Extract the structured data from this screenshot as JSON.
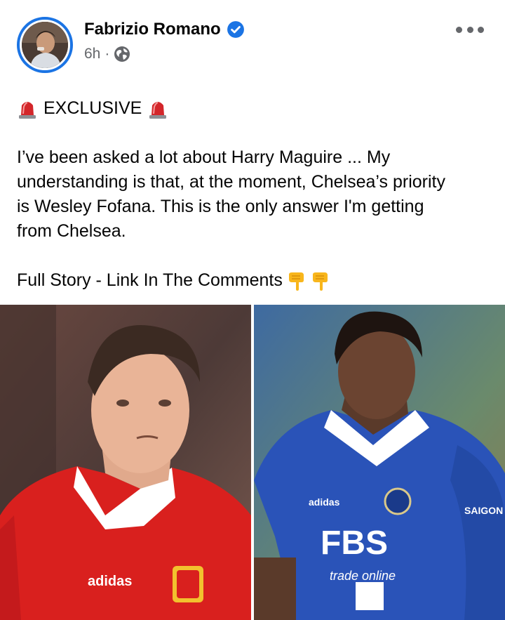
{
  "post": {
    "author": {
      "name": "Fabrizio Romano",
      "verified": true,
      "avatar_icon": "profile-photo"
    },
    "meta": {
      "time": "6h",
      "separator": "·",
      "audience_icon": "globe-icon"
    },
    "more_icon": "more-dots-icon",
    "headline": {
      "emoji_left": "siren-icon",
      "text": "EXCLUSIVE",
      "emoji_right": "siren-icon"
    },
    "body_lines": [
      "I’ve been asked a lot about Harry Maguire ... My",
      "understanding is that, at the moment, Chelsea’s priority",
      "is Wesley Fofana. This is the only answer I'm getting",
      "from Chelsea."
    ],
    "cta": {
      "text": "Full Story - Link In The Comments",
      "emojis": [
        "backhand-index-pointing-down-icon",
        "backhand-index-pointing-down-icon"
      ]
    },
    "images": [
      {
        "subject": "player-in-red-manchester-united-kit",
        "jersey_brand": "adidas"
      },
      {
        "subject": "player-in-blue-leicester-city-kit",
        "jersey_sponsor": "FBS",
        "jersey_sub": "trade online",
        "jersey_brand": "adidas",
        "sleeve_sponsor": "SAIGON"
      }
    ],
    "colors": {
      "accent": "#1b74e4",
      "secondary_text": "#65676b",
      "primary_text": "#050505",
      "red_kit": "#d9201e",
      "blue_kit": "#2a53b8"
    }
  }
}
